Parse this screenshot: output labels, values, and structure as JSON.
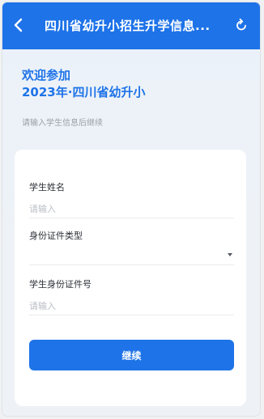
{
  "header": {
    "title": "四川省幼升小招生升学信息...",
    "back_icon": "chevron-left-icon",
    "refresh_icon": "refresh-icon"
  },
  "welcome": {
    "line1": "欢迎参加",
    "line2": "2023年·四川省幼升小"
  },
  "hint": "请输入学生信息后继续",
  "form": {
    "student_name": {
      "label": "学生姓名",
      "placeholder": "请输入"
    },
    "id_type": {
      "label": "身份证件类型",
      "value": ""
    },
    "id_number": {
      "label": "学生身份证件号",
      "placeholder": "请输入"
    },
    "continue_label": "继续"
  },
  "colors": {
    "primary": "#1e73e8",
    "background": "#eef2f6",
    "card": "#ffffff",
    "placeholder": "#b9bec6"
  }
}
